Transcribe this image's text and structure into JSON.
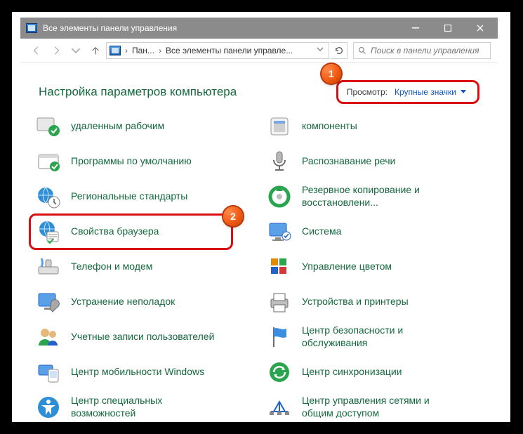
{
  "window": {
    "title": "Все элементы панели управления",
    "sysbuttons": {
      "min": "–",
      "max": "□",
      "close": "×"
    }
  },
  "nav": {
    "crumb1": "Пан...",
    "crumb2": "Все элементы панели управле...",
    "search_placeholder": "Поиск в панели управления"
  },
  "header": {
    "title": "Настройка параметров компьютера",
    "view_label": "Просмотр:",
    "view_value": "Крупные значки"
  },
  "annotations": {
    "b1": "1",
    "b2": "2"
  },
  "items": {
    "left": [
      "удаленным рабочим",
      "Программы по умолчанию",
      "Региональные стандарты",
      "Свойства браузера",
      "Телефон и модем",
      "Устранение неполадок",
      "Учетные записи пользователей",
      "Центр мобильности Windows",
      "Центр специальных возможностей"
    ],
    "right": [
      "компоненты",
      "Распознавание речи",
      "Резервное копирование и восстановлени...",
      "Система",
      "Управление цветом",
      "Устройства и принтеры",
      "Центр безопасности и обслуживания",
      "Центр синхронизации",
      "Центр управления сетями и общим доступом"
    ]
  }
}
